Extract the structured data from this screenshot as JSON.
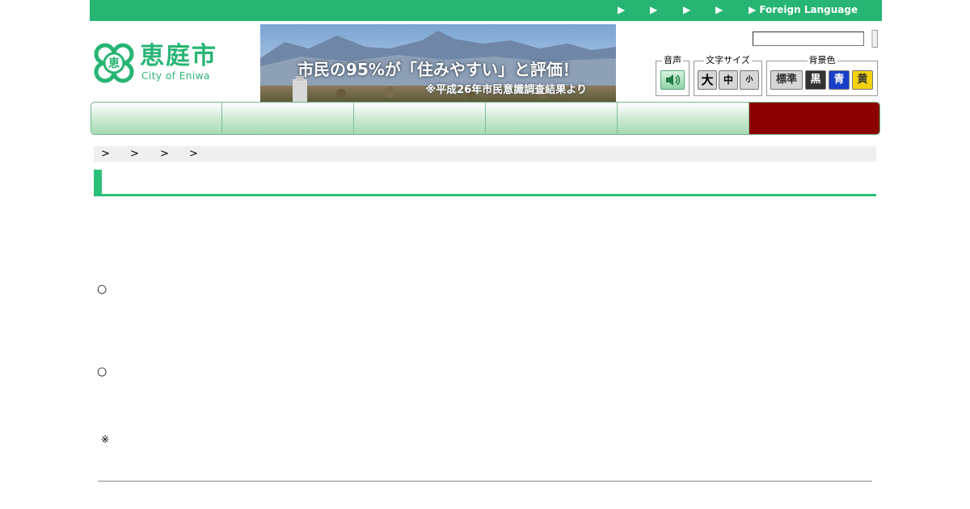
{
  "top_bar": {
    "links": [
      "▶",
      "▶",
      "▶",
      "▶",
      "▶ Foreign Language"
    ]
  },
  "logo": {
    "mark_text": "恵",
    "name_jp": "恵庭市",
    "name_en": "City of Eniwa"
  },
  "banner": {
    "headline": "市民の95%が「住みやすい」と評価！",
    "note": "※平成26年市民意識調査結果より"
  },
  "search": {
    "value": "",
    "placeholder": ""
  },
  "tools": {
    "voice": {
      "label": "音声",
      "icon": "speaker-icon"
    },
    "font_size": {
      "label": "文字サイズ",
      "options": [
        "大",
        "中",
        "小"
      ]
    },
    "bg_color": {
      "label": "背景色",
      "options": [
        "標準",
        "黒",
        "青",
        "黄"
      ]
    }
  },
  "nav": {
    "items": [
      "",
      "",
      "",
      "",
      "",
      ""
    ]
  },
  "breadcrumb": {
    "separators": [
      ">",
      ">",
      ">",
      ">"
    ]
  },
  "content": {
    "marks": [
      "○",
      "○",
      "※"
    ]
  },
  "colors": {
    "brand_green": "#27b573",
    "nav_special": "#8b0000",
    "bg_black": "#333333",
    "bg_blue": "#1a3fc8",
    "bg_yellow": "#f2d10e"
  }
}
